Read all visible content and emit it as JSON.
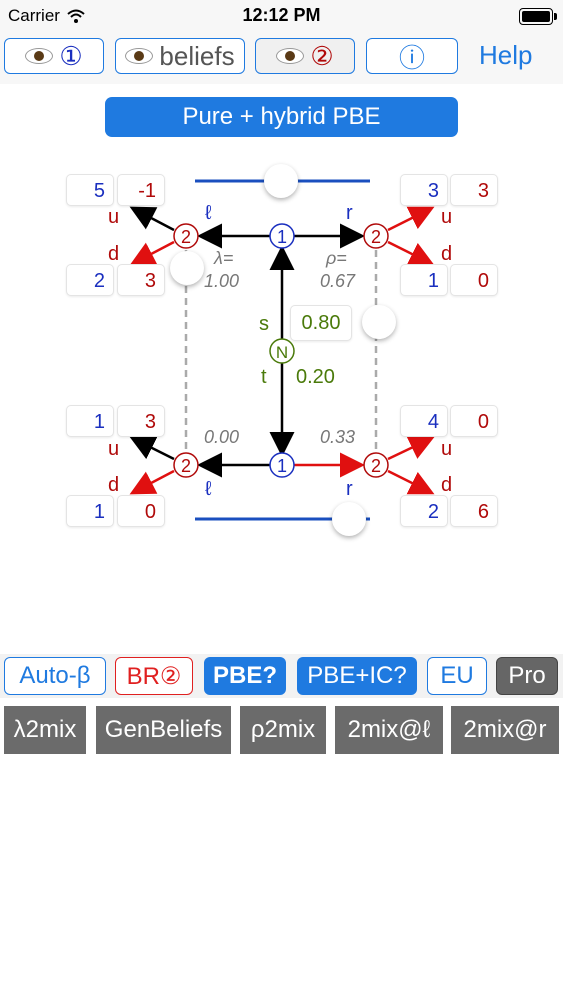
{
  "status": {
    "carrier": "Carrier",
    "time": "12:12 PM"
  },
  "toolbar": {
    "btn1_label": "①",
    "beliefs_label": "beliefs",
    "btn2_label": "②",
    "info_label": "ⓘ",
    "help_label": "Help"
  },
  "banner": {
    "label": "Pure + hybrid PBE"
  },
  "game": {
    "top_left_upper": [
      "5",
      "-1"
    ],
    "top_left_lower": [
      "2",
      "3"
    ],
    "top_right_upper": [
      "3",
      "3"
    ],
    "top_right_lower": [
      "1",
      "0"
    ],
    "bot_left_upper": [
      "1",
      "3"
    ],
    "bot_left_lower": [
      "1",
      "0"
    ],
    "bot_right_upper": [
      "4",
      "0"
    ],
    "bot_right_lower": [
      "2",
      "6"
    ],
    "lambda_label": "λ=",
    "lambda_top": "1.00",
    "rho_label": "ρ=",
    "rho_top": "0.67",
    "lambda_bot": "0.00",
    "rho_bot": "0.33",
    "s_label": "s",
    "s_prob": "0.80",
    "t_label": "t",
    "t_prob": "0.20",
    "nature": "N",
    "l": "ℓ",
    "r": "r",
    "u": "u",
    "d": "d",
    "p1": "1",
    "p2": "2"
  },
  "bar1": {
    "auto_beta": "Auto-β",
    "br2": "BR②",
    "pbe": "PBE?",
    "pbe_ic": "PBE+IC?",
    "eu": "EU",
    "pro": "Pro"
  },
  "bar2": {
    "lambda2mix": "λ2mix",
    "genbeliefs": "GenBeliefs",
    "rho2mix": "ρ2mix",
    "mix_l": "2mix@ℓ",
    "mix_r": "2mix@r"
  },
  "colors": {
    "accent": "#1f7ae0",
    "player1": "#1a2fbf",
    "player2": "#b00a0a",
    "nature": "#4a7a0a"
  }
}
